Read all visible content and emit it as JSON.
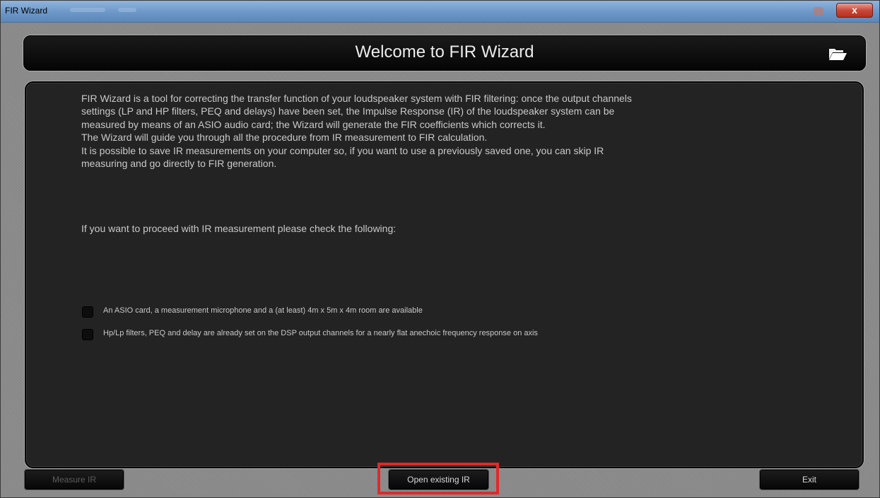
{
  "window": {
    "title": "FIR Wizard",
    "close_label": "x"
  },
  "header": {
    "title": "Welcome to FIR Wizard",
    "icon": "folder-open-icon"
  },
  "intro": {
    "lines": [
      "FIR Wizard is a tool for correcting the transfer function of your loudspeaker system with FIR filtering: once the output channels",
      "settings (LP and HP filters, PEQ and delays) have been set, the Impulse Response (IR) of the loudspeaker system can be",
      "measured by means of an ASIO audio card; the Wizard will generate the FIR coefficients which corrects it.",
      "The Wizard will guide you through all the procedure from IR measurement to FIR calculation.",
      "It is possible to save IR measurements on your computer so, if you want to use a previously saved one, you can skip IR",
      "measuring and go directly to FIR generation."
    ]
  },
  "checklist": {
    "heading": "If you want to proceed with IR measurement please check the following:",
    "items": [
      {
        "label": "An ASIO card, a measurement microphone and a (at least) 4m x 5m x 4m room are available",
        "checked": false
      },
      {
        "label": "Hp/Lp filters, PEQ and delay are already set on the DSP output channels for a nearly flat  anechoic frequency response on axis",
        "checked": false
      }
    ]
  },
  "footer": {
    "measure_label": "Measure IR",
    "measure_enabled": false,
    "open_label": "Open existing IR",
    "exit_label": "Exit"
  },
  "colors": {
    "highlight": "#e02a2a",
    "panel_bg": "#232323",
    "text": "#c9c9c9"
  }
}
